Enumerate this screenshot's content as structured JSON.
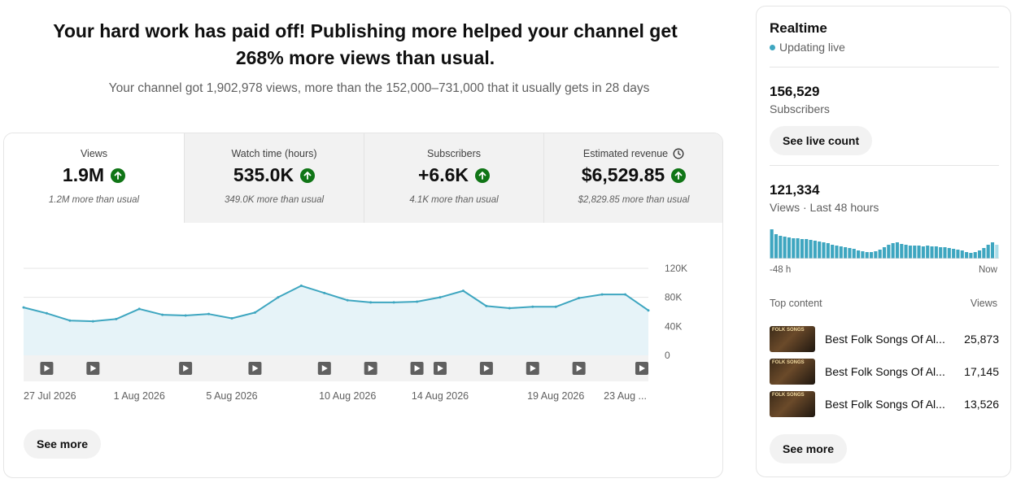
{
  "headline": {
    "line1": "Your hard work has paid off! Publishing more helped your channel get",
    "line2": "268% more views than usual."
  },
  "subline": "Your channel got 1,902,978 views, more than the 152,000–731,000 that it usually gets in 28 days",
  "tabs": [
    {
      "label": "Views",
      "value": "1.9M",
      "note": "1.2M more than usual",
      "active": true
    },
    {
      "label": "Watch time (hours)",
      "value": "535.0K",
      "note": "349.0K more than usual",
      "active": false
    },
    {
      "label": "Subscribers",
      "value": "+6.6K",
      "note": "4.1K more than usual",
      "active": false
    },
    {
      "label": "Estimated revenue",
      "value": "$6,529.85",
      "note": "$2,829.85 more than usual",
      "active": false,
      "icon": "clock-icon"
    }
  ],
  "chart_data": {
    "type": "area",
    "series": [
      {
        "values": [
          66000,
          58000,
          48000,
          47000,
          50000,
          64000,
          56000,
          55000,
          57000,
          51000,
          59000,
          80000,
          96000,
          86000,
          76000,
          73000,
          73000,
          74000,
          80000,
          89000,
          68000,
          65000,
          67000,
          67000,
          79000,
          84000,
          84000,
          62000
        ]
      }
    ],
    "x_tick_labels": [
      "27 Jul 2026",
      "1 Aug 2026",
      "5 Aug 2026",
      "10 Aug 2026",
      "14 Aug 2026",
      "19 Aug 2026",
      "23 Aug ..."
    ],
    "x_tick_index": [
      0,
      5,
      9,
      14,
      18,
      23,
      26
    ],
    "y_tick_labels": [
      "120K",
      "80K",
      "40K",
      "0"
    ],
    "ylim": [
      0,
      120000
    ],
    "grid": true,
    "line_color": "#3ea6c0",
    "fill_color": "#e6f3f8",
    "video_markers_index": [
      1,
      3,
      7,
      10,
      13,
      15,
      17,
      18,
      20,
      22,
      24,
      27
    ]
  },
  "see_more_label": "See more",
  "realtime": {
    "title": "Realtime",
    "status": "Updating live",
    "subscribers_value": "156,529",
    "subscribers_label": "Subscribers",
    "live_count_label": "See live count",
    "views_value": "121,334",
    "views_label": "Views · Last 48 hours",
    "axis_start": "-48 h",
    "axis_end": "Now",
    "mini_bars": [
      36,
      30,
      28,
      27,
      26,
      25,
      25,
      24,
      24,
      23,
      22,
      21,
      20,
      19,
      17,
      16,
      15,
      14,
      13,
      12,
      10,
      9,
      8,
      8,
      9,
      11,
      14,
      17,
      19,
      20,
      18,
      17,
      16,
      16,
      16,
      15,
      16,
      15,
      15,
      14,
      14,
      13,
      12,
      11,
      10,
      8,
      7,
      8,
      10,
      13,
      17,
      20,
      17
    ],
    "top_content_label": "Top content",
    "views_col_label": "Views",
    "top_content": [
      {
        "title": "Best Folk Songs Of Al...",
        "views": "25,873",
        "thumb_text": "FOLK SONGS"
      },
      {
        "title": "Best Folk Songs Of Al...",
        "views": "17,145",
        "thumb_text": "FOLK SONGS"
      },
      {
        "title": "Best Folk Songs Of Al...",
        "views": "13,526",
        "thumb_text": "FOLK SONGS"
      }
    ],
    "see_more_label": "See more"
  }
}
